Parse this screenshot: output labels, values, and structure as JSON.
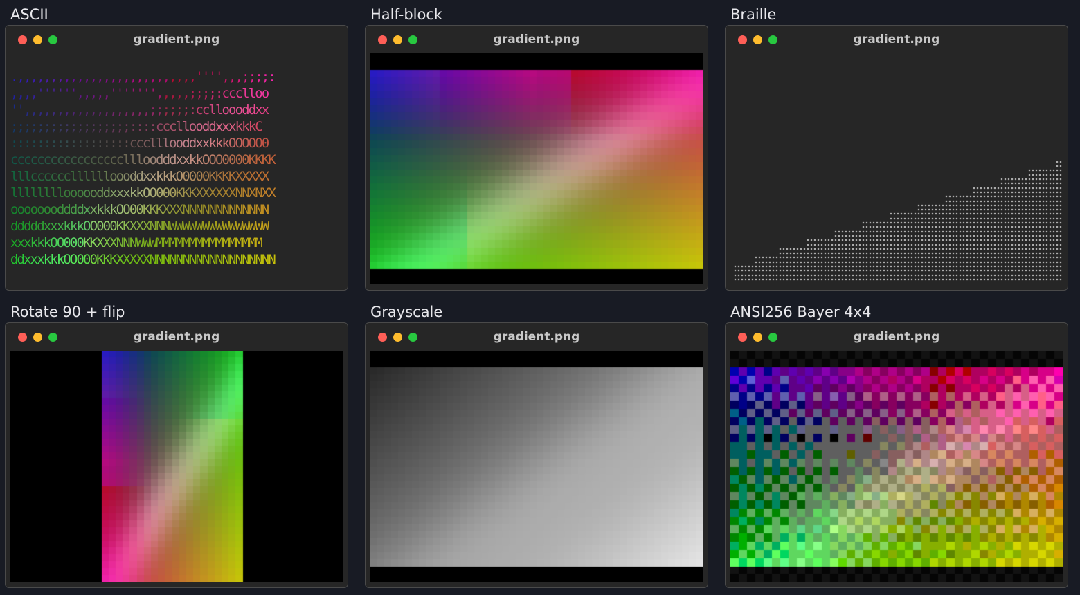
{
  "panels": [
    {
      "label": "ASCII",
      "window_title": "gradient.png",
      "mode": "ascii"
    },
    {
      "label": "Half-block",
      "window_title": "gradient.png",
      "mode": "halfblock"
    },
    {
      "label": "Braille",
      "window_title": "gradient.png",
      "mode": "braille"
    },
    {
      "label": "Rotate 90 + flip",
      "window_title": "gradient.png",
      "mode": "rotate"
    },
    {
      "label": "Grayscale",
      "window_title": "gradient.png",
      "mode": "grayscale"
    },
    {
      "label": "ANSI256 Bayer 4x4",
      "window_title": "gradient.png",
      "mode": "bayer"
    }
  ],
  "ascii_lines": [
    ". , , , , , , , , , , , , , , , , , , , , , , , , , , , ' ' ' ' , , , ; ; ; ; :",
    ", , , , ' ' ' ' ' ' , , , , , ' ' ' ' ' ' ' , , , , , ; ; ; ; : c c c l l o o",
    "' ' , , , , , , , , , , , , , , , , , , , ; ; ; ; ; ; : c c l l o o o d d x x",
    "; ; ; ; ; ; ; ; ; ; ; ; ; ; ; ; ; ; : : : : c c c l l o o d d x x x k k k C",
    ": : : : : : : : : : : : : : : : : : c c c l l l o o d d x x k k k O O O O O 0",
    "c c c c c c c c c c c c c c c c c l l l o o d d d x x k k O O O 0 0 0 0 K K K K",
    "l l l c c c c c c l l l l l l o o o d d x x k k k O 0 0 0 0 K K K K X X X X X",
    "l l l l l l l l o o o o o d d x x x k k O O 0 0 0 K K K X X X X X X N N X N X X",
    "o o o o o o o d d d d x x k k k O O 0 0 K K K X X X N N N N N N N N N N N N N",
    "d d d d d x x x k k k O O 0 0 0 K K X X X N N N W W W W W W W W W W W W W W W",
    "x x x k k k O O 0 0 0 K K X X X N N N W W W M M M M M M M M M M M M M M M M",
    "d d x x x k k k O O 0 0 0 K K K X X X X X N N N N N N N N N N N N N N N N N N N",
    ". . . . . . . . . . . . . . . . . . . . . . . . ."
  ]
}
